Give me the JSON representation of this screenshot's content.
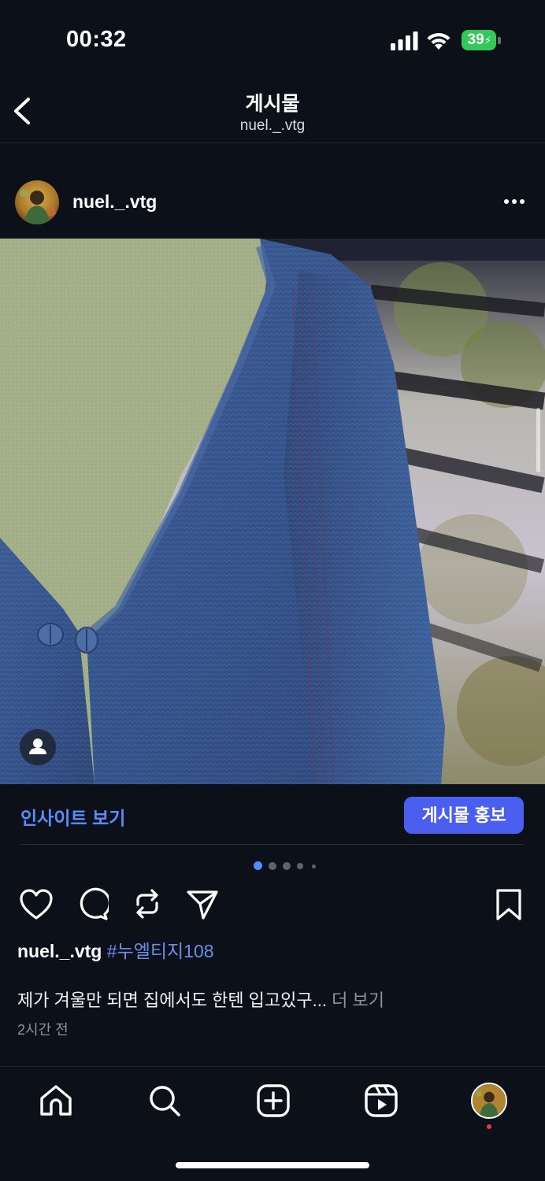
{
  "status_bar": {
    "time": "00:32",
    "battery": "39"
  },
  "header": {
    "title": "게시물",
    "subtitle": "nuel._.vtg"
  },
  "post": {
    "username": "nuel._.vtg",
    "insight_label": "인사이트 보기",
    "promote_label": "게시물 홍보",
    "carousel_total": 5,
    "carousel_active": 1,
    "caption_user": "nuel._.vtg",
    "caption_hashtag": "#누엘티지108",
    "caption_text": "제가 겨울만 되면 집에서도 한텐 입고있구...",
    "caption_more": "더 보기",
    "timestamp": "2시간 전"
  },
  "colors": {
    "accent": "#4a5ff0",
    "link": "#5b8cff",
    "background": "#0c1018"
  }
}
